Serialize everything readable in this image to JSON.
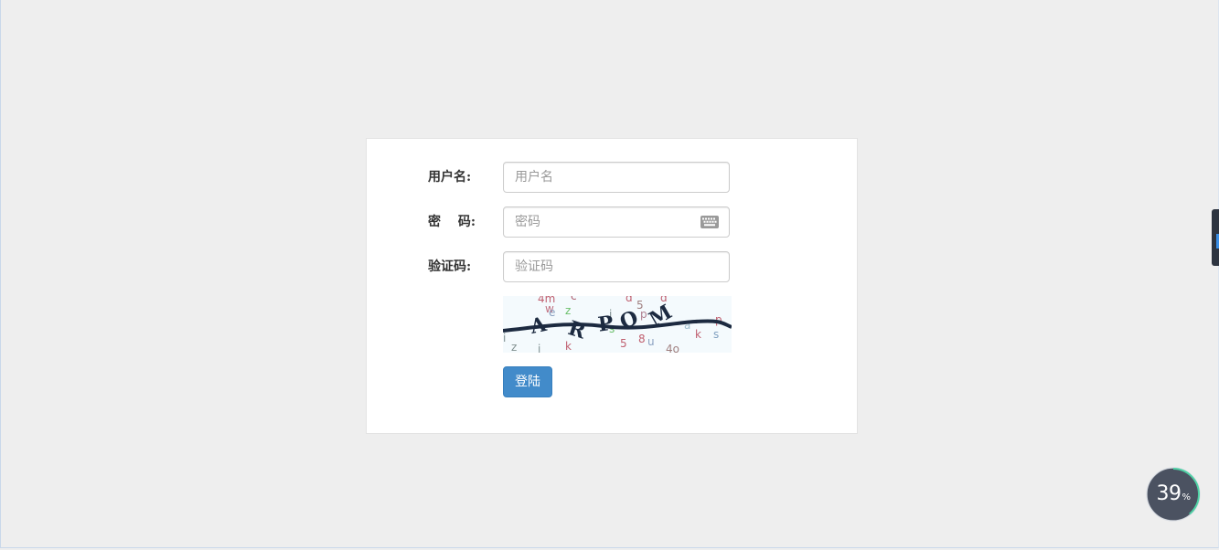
{
  "form": {
    "username_label": "用户名:",
    "username_placeholder": "用户名",
    "password_label_a": "密",
    "password_label_b": "码:",
    "password_placeholder": "密码",
    "captcha_label": "验证码:",
    "captcha_placeholder": "验证码",
    "captcha_text": "ARPOM",
    "submit_label": "登陆"
  },
  "widget": {
    "percent": "39",
    "unit": "%",
    "progress_fraction": 0.39
  },
  "colors": {
    "page_bg": "#eeeeee",
    "panel_bg": "#ffffff",
    "button_bg": "#428bca",
    "widget_bg": "#5a6170",
    "widget_ring": "#4fd1a5"
  }
}
